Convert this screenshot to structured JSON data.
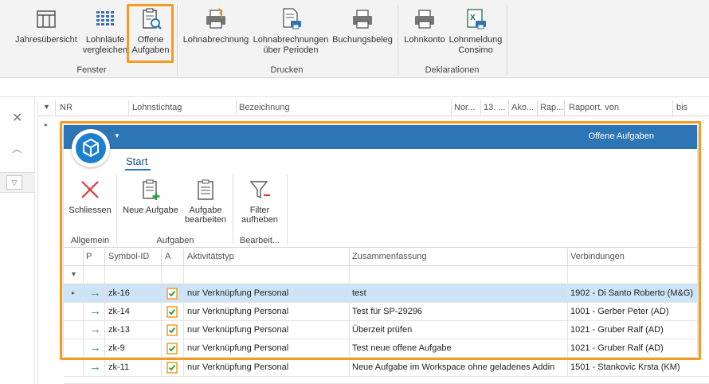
{
  "ribbon": {
    "buttons": [
      {
        "label1": "Jahresübersicht",
        "label2": ""
      },
      {
        "label1": "Lohnläufe",
        "label2": "vergleichen"
      },
      {
        "label1": "Offene",
        "label2": "Aufgaben"
      },
      {
        "label1": "Lohnabrechnung",
        "label2": ""
      },
      {
        "label1": "Lohnabrechnungen",
        "label2": "über Perioden"
      },
      {
        "label1": "Buchungsbeleg",
        "label2": ""
      },
      {
        "label1": "Lohnkonto",
        "label2": ""
      },
      {
        "label1": "Lohnmeldung",
        "label2": "Consimo"
      }
    ],
    "groups": {
      "fenster": "Fenster",
      "drucken": "Drucken",
      "deklarationen": "Deklarationen"
    },
    "highlight_color": "#f59a23"
  },
  "background_grid": {
    "columns": [
      "NR",
      "Lohnstichtag",
      "Bezeichnung",
      "Nor...",
      "13. ...",
      "Ako...",
      "Rap...",
      "Rapport. von",
      "bis"
    ]
  },
  "dialog": {
    "title": "Offene Aufgaben",
    "tab": "Start",
    "title_color": "#2e75b6",
    "buttons": {
      "schliessen": "Schliessen",
      "neue_aufgabe": "Neue Aufgabe",
      "bearbeiten1": "Aufgabe",
      "bearbeiten2": "bearbeiten",
      "filter1": "Filter",
      "filter2": "aufheben"
    },
    "groups": {
      "allgemein": "Allgemein",
      "aufgaben": "Aufgaben",
      "bearbeiten": "Bearbeit..."
    },
    "grid": {
      "columns": [
        "P",
        "Symbol-ID",
        "A",
        "Aktivitätstyp",
        "Zusammenfassung",
        "Verbindungen"
      ],
      "rows": [
        {
          "id": "zk-16",
          "typ": "nur Verknüpfung Personal",
          "summary": "test",
          "link": "1902 - Di Santo Roberto (M&G)"
        },
        {
          "id": "zk-14",
          "typ": "nur Verknüpfung Personal",
          "summary": "Test für SP-29296",
          "link": "1001 - Gerber Peter (AD)"
        },
        {
          "id": "zk-13",
          "typ": "nur Verknüpfung Personal",
          "summary": "Überzeit prüfen",
          "link": "1021 - Gruber Ralf (AD)"
        },
        {
          "id": "zk-9",
          "typ": "nur Verknüpfung Personal",
          "summary": "Test neue offene Aufgabe",
          "link": "1021 - Gruber Ralf (AD)"
        },
        {
          "id": "zk-11",
          "typ": "nur Verknüpfung Personal",
          "summary": "Neue Aufgabe im Workspace ohne geladenes Addin",
          "link": "1501 - Stankovic Krsta (KM)"
        }
      ]
    }
  },
  "icons": {
    "close": "close-icon",
    "up": "chevron-up-icon",
    "filter": "filter-icon",
    "arrow": "green-arrow-icon",
    "task": "task-check-icon"
  }
}
